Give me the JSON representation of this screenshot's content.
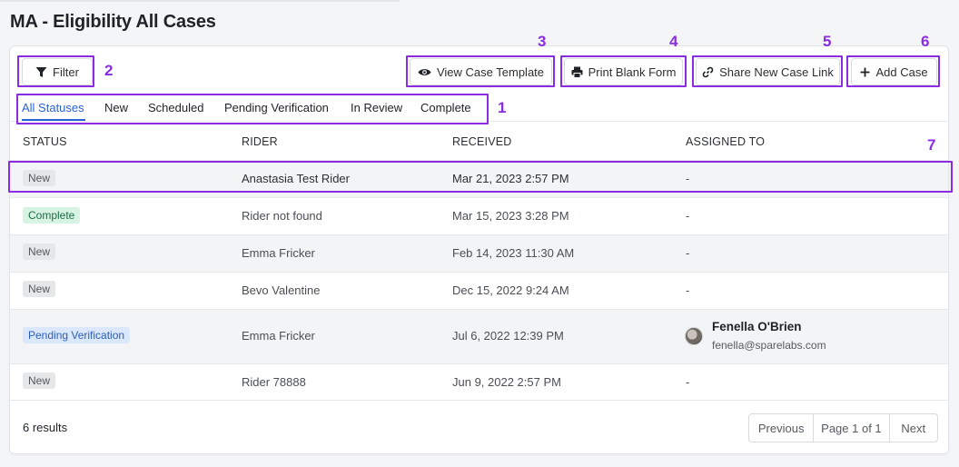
{
  "page": {
    "title": "MA - Eligibility All Cases"
  },
  "toolbar": {
    "filter_label": "Filter",
    "view_template_label": "View Case Template",
    "print_form_label": "Print Blank Form",
    "share_link_label": "Share New Case Link",
    "add_case_label": "Add Case"
  },
  "tabs": [
    {
      "label": "All Statuses",
      "active": true
    },
    {
      "label": "New"
    },
    {
      "label": "Scheduled"
    },
    {
      "label": "Pending Verification"
    },
    {
      "label": "In Review"
    },
    {
      "label": "Complete"
    }
  ],
  "table": {
    "headers": [
      "STATUS",
      "RIDER",
      "RECEIVED",
      "ASSIGNED TO"
    ],
    "rows": [
      {
        "status": "New",
        "rider": "Anastasia Test Rider",
        "received": "Mar 21, 2023 2:57 PM",
        "assigned": "-"
      },
      {
        "status": "Complete",
        "rider": "Rider not found",
        "received": "Mar 15, 2023 3:28 PM",
        "assigned": "-"
      },
      {
        "status": "New",
        "rider": "Emma Fricker",
        "received": "Feb 14, 2023 11:30 AM",
        "assigned": "-"
      },
      {
        "status": "New",
        "rider": "Bevo Valentine",
        "received": "Dec 15, 2022 9:24 AM",
        "assigned": "-"
      },
      {
        "status": "Pending Verification",
        "rider": "Emma Fricker",
        "received": "Jul 6, 2022 12:39 PM",
        "assigned_name": "Fenella O'Brien",
        "assigned_email": "fenella@sparelabs.com"
      },
      {
        "status": "New",
        "rider": "Rider 78888",
        "received": "Jun 9, 2022 2:57 PM",
        "assigned": "-"
      }
    ]
  },
  "footer": {
    "results": "6 results",
    "previous_label": "Previous",
    "page_label": "Page 1 of 1",
    "next_label": "Next"
  },
  "annotations": [
    "1",
    "2",
    "3",
    "4",
    "5",
    "6",
    "7"
  ],
  "colors": {
    "annotation": "#8b2be2",
    "active_tab": "#2962d9",
    "badge_new": "#e6e7e9",
    "badge_complete": "#d6f3e3",
    "badge_pending": "#dbe8fb"
  },
  "icons": [
    "filter-icon",
    "eye-icon",
    "printer-icon",
    "link-icon",
    "plus-icon"
  ]
}
